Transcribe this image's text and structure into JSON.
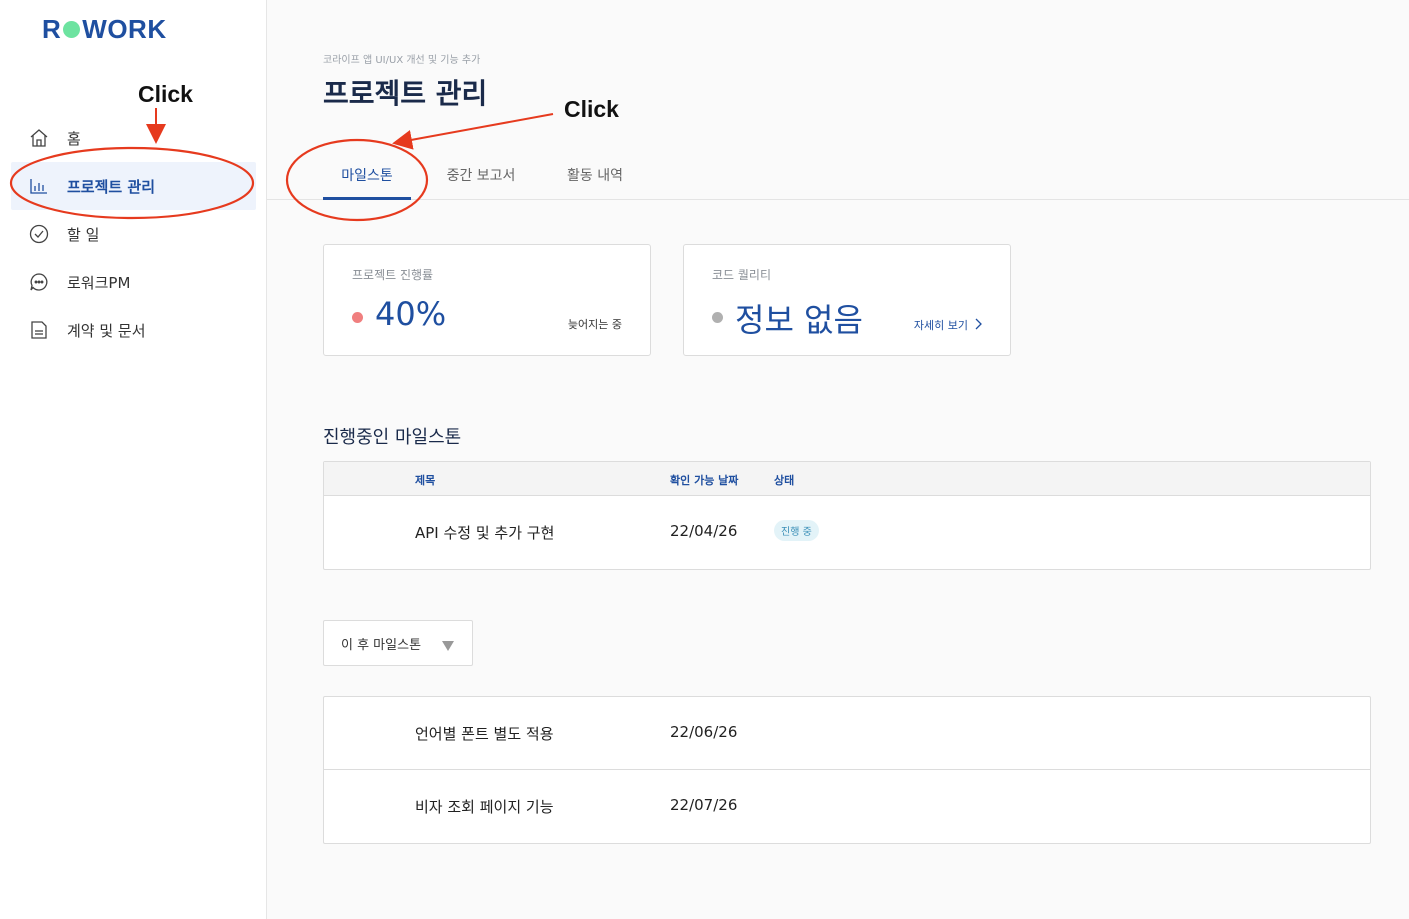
{
  "sidebar": {
    "logo": {
      "left": "R",
      "right": "WORK",
      "accent_color": "#6de3a0"
    },
    "items": [
      {
        "label": "홈",
        "icon": "home-icon"
      },
      {
        "label": "프로젝트 관리",
        "icon": "bar-chart-icon",
        "active": true
      },
      {
        "label": "할 일",
        "icon": "check-circle-icon"
      },
      {
        "label": "로워크PM",
        "icon": "chat-bubble-icon"
      },
      {
        "label": "계약 및 문서",
        "icon": "document-icon"
      }
    ]
  },
  "header": {
    "breadcrumb": "코라이프 앱 UI/UX 개선 및 기능 추가",
    "title": "프로젝트 관리"
  },
  "tabs": [
    {
      "label": "마일스톤",
      "active": true
    },
    {
      "label": "중간 보고서"
    },
    {
      "label": "활동 내역"
    }
  ],
  "cards": {
    "progress": {
      "label": "프로젝트 진행률",
      "value": "40%",
      "note": "늦어지는 중",
      "dot_color": "#f07f7f"
    },
    "quality": {
      "label": "코드 퀄리티",
      "value": "정보 없음",
      "link": "자세히 보기",
      "dot_color": "#b0b0b0"
    }
  },
  "current": {
    "title": "진행중인 마일스톤",
    "columns": [
      "제목",
      "확인 가능 날짜",
      "상태"
    ],
    "rows": [
      {
        "title": "API 수정 및 추가 구현",
        "date": "22/04/26",
        "status": "진행 중"
      }
    ]
  },
  "upcoming": {
    "dropdown_label": "이 후 마일스톤",
    "rows": [
      {
        "title": "언어별 폰트 별도 적용",
        "date": "22/06/26"
      },
      {
        "title": "비자 조회 페이지 기능",
        "date": "22/07/26"
      }
    ]
  },
  "annotations": {
    "click_label": "Click",
    "color": "#e63a1e"
  },
  "colors": {
    "brand": "#1f4fa0",
    "badge_bg": "#e3f3f8",
    "badge_text": "#3a8fb7"
  }
}
